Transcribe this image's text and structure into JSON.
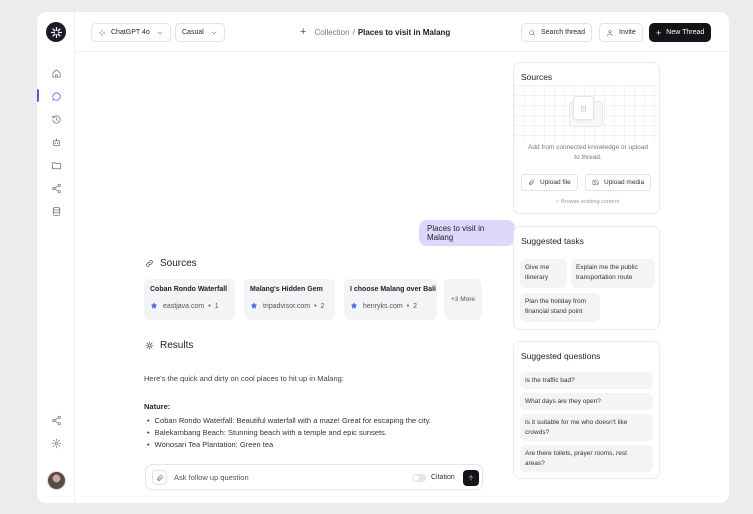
{
  "topbar": {
    "model_label": "ChatGPT 4o",
    "mode_label": "Casual",
    "breadcrumb_collection": "Collection",
    "breadcrumb_separator": "/",
    "breadcrumb_current": "Places to visit in Malang",
    "search_label": "Search thread",
    "invite_label": "Invite",
    "new_thread_label": "New Thread"
  },
  "sidebar": {
    "items": [
      {
        "icon": "home-icon"
      },
      {
        "icon": "chat-icon",
        "active": true
      },
      {
        "icon": "history-icon"
      },
      {
        "icon": "robot-icon"
      },
      {
        "icon": "folder-icon"
      },
      {
        "icon": "share-icon"
      },
      {
        "icon": "database-icon"
      }
    ],
    "bottom": [
      {
        "icon": "share-icon"
      },
      {
        "icon": "settings-icon"
      }
    ]
  },
  "chat": {
    "user_message": "Places to visit in Malang",
    "sources_heading": "Sources",
    "sources": [
      {
        "title": "Coban Rondo Waterfall",
        "site": "eastjava.com",
        "dot": "•",
        "count": "1"
      },
      {
        "title": "Malang's Hidden Gem",
        "site": "tripadvisor.com",
        "dot": "•",
        "count": "2"
      },
      {
        "title": "I choose Malang over Bali",
        "site": "henryks.com",
        "dot": "•",
        "count": "2"
      }
    ],
    "more_sources": "+3 More",
    "results_heading": "Results",
    "intro": "Here's the quick and dirty on cool places to hit up in Malang:",
    "nature_heading": "Nature:",
    "nature_items": [
      "Coban Rondo Waterfall: Beautiful waterfall with a maze! Great for escaping the city.",
      "Balekambang Beach: Stunning beach with a temple and epic sunsets.",
      "Wonosari Tea Plantation: Green tea"
    ],
    "composer_placeholder": "Ask follow up question",
    "citation_label": "Citation"
  },
  "panel_sources": {
    "title": "Sources",
    "description": "Add from connected knowledge or upload to thread.",
    "upload_file": "Upload file",
    "upload_media": "Upload media",
    "browse": "Browse existing content"
  },
  "panel_tasks": {
    "title": "Suggested tasks",
    "items": [
      "Give me itinerary",
      "Explain me the public transportation route",
      "Plan the holiday from financial stand point"
    ]
  },
  "panel_questions": {
    "title": "Suggested questions",
    "items": [
      "Is the traffic bad?",
      "What days are they open?",
      "Is it suitable for me who doesn't like crowds?",
      "Are there toilets, prayer rooms, rest areas?"
    ]
  },
  "colors": {
    "accent": "#6a4df0",
    "user_bubble": "#dcd8fb",
    "primary_button": "#141418"
  }
}
